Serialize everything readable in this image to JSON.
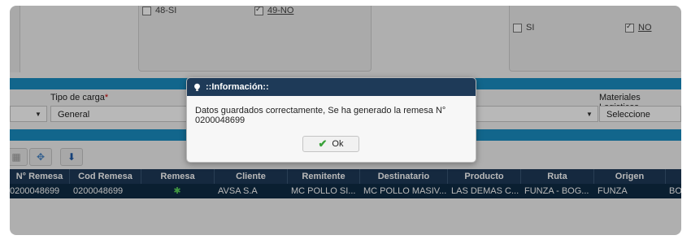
{
  "checkboxes_top": [
    {
      "label": "48-SI",
      "checked": false,
      "underline": false
    },
    {
      "label": "49-NO",
      "checked": true,
      "underline": true
    }
  ],
  "checkboxes_right": [
    {
      "label": "SI",
      "checked": false,
      "underline": false
    },
    {
      "label": "NO",
      "checked": true,
      "underline": true
    }
  ],
  "form": {
    "tipo_carga_label": "Tipo de carga",
    "tipo_carga_required": "*",
    "tipo_carga_value": "General",
    "materiales_label": "Materiales Logisticos",
    "materiales_value": "Seleccione"
  },
  "grid": {
    "columns": [
      "N° Remesa",
      "Cod Remesa",
      "Remesa",
      "Cliente",
      "Remitente",
      "Destinatario",
      "Producto",
      "Ruta",
      "Origen"
    ],
    "row": [
      "0200048699",
      "0200048699",
      "",
      "AVSA S.A",
      "MC POLLO SI...",
      "MC POLLO MASIV...",
      "LAS DEMAS C...",
      "FUNZA - BOG...",
      "FUNZA",
      "BO"
    ]
  },
  "dialog": {
    "title": "::Información::",
    "message": "Datos guardados correctamente, Se ha generado la remesa N° 0200048699",
    "ok_label": "Ok"
  },
  "colors": {
    "header_bar": "#1e3a58",
    "accent_blue": "#1a8ec2"
  }
}
